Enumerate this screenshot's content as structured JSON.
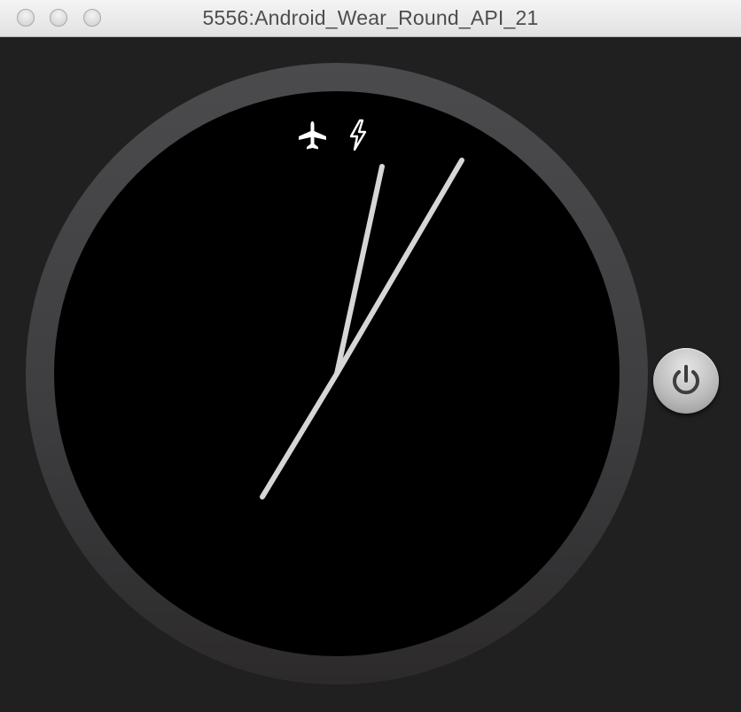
{
  "window": {
    "title": "5556:Android_Wear_Round_API_21",
    "buttons": [
      "close",
      "minimize",
      "zoom"
    ]
  },
  "watch": {
    "status_icons": [
      "airplane-mode-icon",
      "charging-bolt-icon"
    ],
    "colors": {
      "bezel": "#4a4a4c",
      "face": "#000000",
      "hands": "#d9d9d9",
      "status_icons": "#ffffff"
    }
  },
  "controls": {
    "power_button_icon": "power-icon"
  }
}
